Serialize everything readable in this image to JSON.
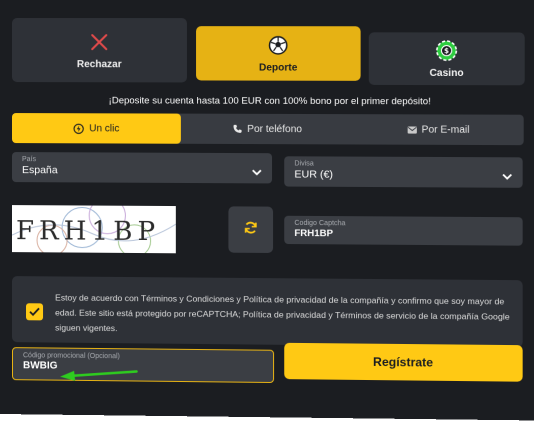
{
  "bonus_options": [
    {
      "label": "Rechazar",
      "icon": "close-icon"
    },
    {
      "label": "Deporte",
      "icon": "soccer-ball-icon"
    },
    {
      "label": "Casino",
      "icon": "casino-chips-icon"
    }
  ],
  "promo_text": "¡Deposite su cuenta hasta 100 EUR con 100% bono por el primer depósito!",
  "methods": [
    {
      "label": "Un clic",
      "icon": "lightning-icon",
      "active": true
    },
    {
      "label": "Por teléfono",
      "icon": "phone-icon"
    },
    {
      "label": "Por E-mail",
      "icon": "envelope-icon"
    }
  ],
  "country": {
    "label": "País",
    "value": "España"
  },
  "currency": {
    "label": "Divisa",
    "value": "EUR (€)"
  },
  "captcha": {
    "image_text": "FRH1BP",
    "input_label": "Codigo Captcha",
    "input_value": "FRH1BP"
  },
  "consent_text": "Estoy de acuerdo con Términos y Condiciones y Política de privacidad de la compañía y confirmo que soy mayor de edad. Este sitio está protegido por reCAPTCHA; Política de privacidad y Términos de servicio de la compañía Google siguen vigentes.",
  "promo_code": {
    "label": "Código promocional (Opcional)",
    "value": "BWBIG"
  },
  "register_label": "Regístrate",
  "colors": {
    "accent": "#ffc914",
    "background": "#1b1d21",
    "field": "#3b3e44",
    "arrow": "#2ecc1f",
    "reject": "#e04a4a"
  }
}
